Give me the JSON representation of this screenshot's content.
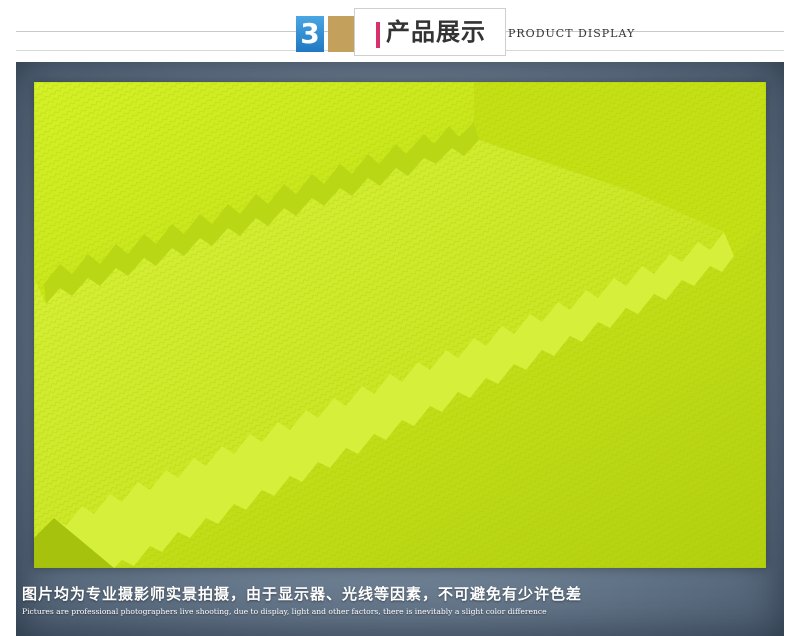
{
  "header": {
    "section_number": "3",
    "title_cn": "产品展示",
    "title_en": "PRODUCT DISPLAY"
  },
  "product_image": {
    "subject": "fabric-swatch-pinked-edges",
    "colors": {
      "fabric": "#cdee1c",
      "fabric_shadow": "#a9c80f",
      "fabric_highlight": "#dff64a",
      "frame": "#6d7f92",
      "badge": "#2a8ad0",
      "accent_bar": "#d8306c",
      "tan_block": "#c3a15c"
    }
  },
  "caption": {
    "cn": "图片均为专业摄影师实景拍摄，由于显示器、光线等因素，不可避免有少许色差",
    "en": "Pictures are professional photographers live shooting, due to display, light and other factors, there is inevitably a slight color difference"
  }
}
